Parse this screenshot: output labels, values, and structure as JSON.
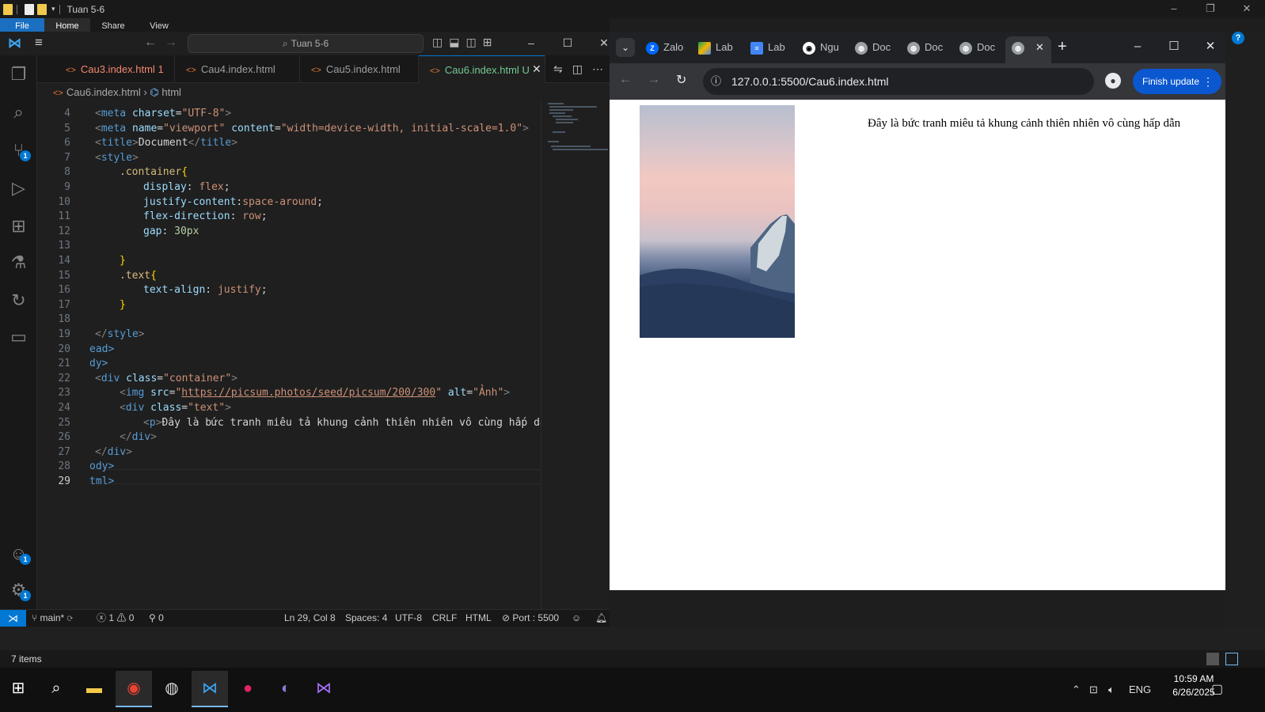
{
  "explorer": {
    "title": "Tuan 5-6",
    "ribbon": [
      "File",
      "Home",
      "Share",
      "View"
    ],
    "status_items": "7 items"
  },
  "vscode": {
    "search_text": "Tuan 5-6",
    "tabs": [
      {
        "label": "Cau3.index.html",
        "suffix": "1",
        "state": "error"
      },
      {
        "label": "Cau4.index.html",
        "suffix": "",
        "state": "normal"
      },
      {
        "label": "Cau5.index.html",
        "suffix": "",
        "state": "normal"
      },
      {
        "label": "Cau6.index.html",
        "suffix": "U",
        "state": "active"
      }
    ],
    "breadcrumb": {
      "file": "Cau6.index.html",
      "node": "html"
    },
    "code_lines": [
      {
        "n": "4"
      },
      {
        "n": "5"
      },
      {
        "n": "6"
      },
      {
        "n": "7"
      },
      {
        "n": "8"
      },
      {
        "n": "9"
      },
      {
        "n": "10"
      },
      {
        "n": "11"
      },
      {
        "n": "12"
      },
      {
        "n": "13"
      },
      {
        "n": "14"
      },
      {
        "n": "15"
      },
      {
        "n": "16"
      },
      {
        "n": "17"
      },
      {
        "n": "18"
      },
      {
        "n": "19"
      },
      {
        "n": "20"
      },
      {
        "n": "21"
      },
      {
        "n": "22"
      },
      {
        "n": "23"
      },
      {
        "n": "24"
      },
      {
        "n": "25"
      },
      {
        "n": "26"
      },
      {
        "n": "27"
      },
      {
        "n": "28"
      },
      {
        "n": "29"
      }
    ],
    "code": {
      "l4_charset": "\"UTF-8\"",
      "l5_content": "\"width=device-width, initial-scale=1.0\"",
      "l6_title": "Document",
      "l8_selector": ".container",
      "l9_val": "flex",
      "l10_val": "space-around",
      "l11_val": "row",
      "l12_val": "30px",
      "l15_selector": ".text",
      "l16_val": "justify",
      "l20_text": "ead>",
      "l21_text": "dy>",
      "l22_class": "\"container\"",
      "l23_src": "https://picsum.photos/seed/picsum/200/300",
      "l23_alt": "\"Ảnh\"",
      "l24_class": "\"text\"",
      "l25_text": "Đây là bức tranh miêu tả khung cảnh thiên nhiên vô cùng hấp dẫn",
      "l28_text": "ody>",
      "l29_text": "tml>"
    },
    "status": {
      "branch": "main*",
      "errors": "1",
      "warnings": "0",
      "ports": "0",
      "cursor": "Ln 29, Col 8",
      "spaces": "Spaces: 4",
      "encoding": "UTF-8",
      "eol": "CRLF",
      "language": "HTML",
      "port": "Port : 5500"
    },
    "badges": {
      "scm": "1",
      "accounts": "1",
      "settings": "1"
    }
  },
  "chrome": {
    "tabs": [
      "Zalo",
      "Lab",
      "Lab",
      "Ngu",
      "Doc",
      "Doc",
      "Doc"
    ],
    "url": "127.0.0.1:5500/Cau6.index.html",
    "finish_update": "Finish update",
    "page_text": "Đây là bức tranh miêu tả khung cảnh thiên nhiên vô cùng hấp dẫn"
  },
  "taskbar": {
    "lang": "ENG",
    "time": "10:59 AM",
    "date": "6/26/2025"
  },
  "colors": {
    "accent": "#0078d4",
    "chrome_update": "#0b57d0",
    "tab_modified": "#73c991",
    "tab_error": "#f48771"
  }
}
